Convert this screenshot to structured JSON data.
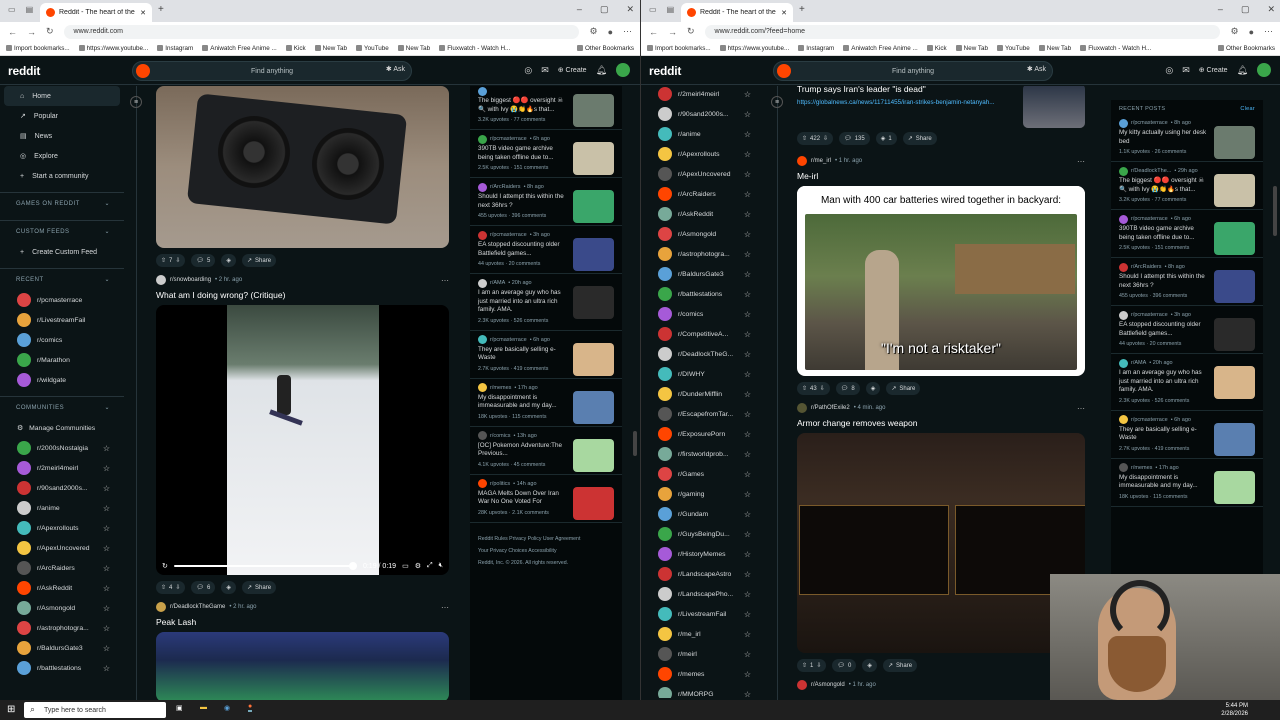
{
  "tab_title": "Reddit - The heart of the intern",
  "left_url": "www.reddit.com",
  "right_url": "www.reddit.com/?feed=home",
  "bookmarks": [
    "Import bookmarks...",
    "https://www.youtube...",
    "Instagram",
    "Aniwatch Free Anime ...",
    "Kick",
    "New Tab",
    "YouTube",
    "New Tab",
    "Fluxwatch - Watch H..."
  ],
  "other_bookmarks": "Other Bookmarks",
  "header": {
    "logo": "reddit",
    "search_placeholder": "Find anything",
    "ask": "Ask",
    "create": "Create"
  },
  "nav": [
    "Home",
    "Popular",
    "News",
    "Explore",
    "Start a community"
  ],
  "sections": {
    "games": "GAMES ON REDDIT",
    "custom": "CUSTOM FEEDS",
    "custom_item": "Create Custom Feed",
    "recent": "RECENT",
    "communities": "COMMUNITIES",
    "manage": "Manage Communities"
  },
  "recent": [
    "r/pcmasterrace",
    "r/LivestreamFail",
    "r/comics",
    "r/Marathon",
    "r/wildgate"
  ],
  "communities_left": [
    "r/2000sNostalgia",
    "r/2meirl4meirl",
    "r/90sand2000s...",
    "r/anime",
    "r/Apexrollouts",
    "r/ApexUncovered",
    "r/ArcRaiders",
    "r/AskReddit",
    "r/Asmongold",
    "r/astrophotogra...",
    "r/BaldursGate3",
    "r/battlestations"
  ],
  "communities_right": [
    "r/2meirl4meirl",
    "r/90sand2000s...",
    "r/anime",
    "r/Apexrollouts",
    "r/ApexUncovered",
    "r/ArcRaiders",
    "r/AskReddit",
    "r/Asmongold",
    "r/astrophotogra...",
    "r/BaldursGate3",
    "r/battlestations",
    "r/comics",
    "r/CompetitiveA...",
    "r/DeadlockTheG...",
    "r/DIWHY",
    "r/DunderMifflin",
    "r/EscapefromTar...",
    "r/ExposurePorn",
    "r/firstworldprob...",
    "r/Games",
    "r/gaming",
    "r/Gundam",
    "r/GuysBeingDu...",
    "r/HistoryMemes",
    "r/LandscapeAstro",
    "r/LandscapePho...",
    "r/LivestreamFail",
    "r/me_irl",
    "r/meirl",
    "r/memes",
    "r/MMORPG"
  ],
  "left_feed": [
    {
      "votes": "7",
      "comments": "5",
      "share": "Share"
    },
    {
      "sub": "r/snowboarding",
      "time": "• 2 hr. ago",
      "title": "What am I doing wrong? (Critique)",
      "video_time": "0:19 / 0:19",
      "votes": "4",
      "comments": "6",
      "share": "Share"
    },
    {
      "sub": "r/DeadlockTheGame",
      "time": "• 2 hr. ago",
      "title": "Peak Lash"
    }
  ],
  "rail_left": [
    {
      "sub": "",
      "time": "",
      "title": "The biggest 🔴🔴 oversight ☠🔍 with Ivy 😭👏🔥s that...",
      "stats": "3.2K upvotes · 77 comments"
    },
    {
      "sub": "r/pcmasterrace",
      "time": "• 6h ago",
      "title": "390TB video game archive being taken offline due to...",
      "stats": "2.5K upvotes · 151 comments"
    },
    {
      "sub": "r/ArcRaiders",
      "time": "• 8h ago",
      "title": "Should I attempt this within the next 36hrs ?",
      "stats": "455 upvotes · 396 comments"
    },
    {
      "sub": "r/pcmasterrace",
      "time": "• 3h ago",
      "title": "EA stopped discounting older Battlefield games...",
      "stats": "44 upvotes · 20 comments"
    },
    {
      "sub": "r/AMA",
      "time": "• 20h ago",
      "title": "I am an average guy who has just married into an ultra rich family. AMA.",
      "stats": "2.3K upvotes · 526 comments"
    },
    {
      "sub": "r/pcmasterrace",
      "time": "• 6h ago",
      "title": "They are basically selling e-Waste",
      "stats": "2.7K upvotes · 419 comments"
    },
    {
      "sub": "r/memes",
      "time": "• 17h ago",
      "title": "My disappointment is immeasurable and my day...",
      "stats": "18K upvotes · 115 comments"
    },
    {
      "sub": "r/comics",
      "time": "• 13h ago",
      "title": "[OC] Pokemon Adventure:The Previous...",
      "stats": "4.1K upvotes · 45 comments"
    },
    {
      "sub": "r/politics",
      "time": "• 14h ago",
      "title": "MAGA Melts Down Over Iran War No One Voted For",
      "stats": "28K upvotes · 2.1K comments"
    }
  ],
  "footer": [
    "Reddit Rules",
    "Privacy Policy",
    "User Agreement",
    "Your Privacy Choices",
    "Accessibility",
    "Reddit, Inc. © 2026. All rights reserved."
  ],
  "right_feed": [
    {
      "title": "Trump says Iran's leader \"is dead\"",
      "link": "https://globalnews.ca/news/11711455/iran-strikes-benjamin-netanyah...",
      "votes": "422",
      "comments": "135",
      "award": "1",
      "share": "Share"
    },
    {
      "sub": "r/me_irl",
      "time": "• 1 hr. ago",
      "title": "Me-irl",
      "caption": "Man with 400 car batteries wired together in backyard:",
      "subtitle": "\"I'm not a risktaker\"",
      "votes": "43",
      "comments": "8",
      "share": "Share"
    },
    {
      "sub": "r/PathOfExile2",
      "time": "• 4 min. ago",
      "title": "Armor change removes weapon",
      "votes": "1",
      "comments": "0",
      "share": "Share"
    },
    {
      "sub": "r/Asmongold",
      "time": "• 1 hr. ago"
    }
  ],
  "rail_right_header": {
    "title": "RECENT POSTS",
    "clear": "Clear"
  },
  "rail_right": [
    {
      "sub": "r/pcmasterrace",
      "time": "• 8h ago",
      "title": "My kitty actually using her desk bed",
      "stats": "1.1K upvotes · 26 comments"
    },
    {
      "sub": "r/DeadlockThe...",
      "time": "• 29h ago",
      "title": "The biggest 🔴🔴 oversight ☠🔍 with Ivy 😭👏🔥s that...",
      "stats": "3.2K upvotes · 77 comments"
    },
    {
      "sub": "r/pcmasterrace",
      "time": "• 6h ago",
      "title": "390TB video game archive being taken offline due to...",
      "stats": "2.5K upvotes · 151 comments"
    },
    {
      "sub": "r/ArcRaiders",
      "time": "• 8h ago",
      "title": "Should I attempt this within the next 36hrs ?",
      "stats": "455 upvotes · 396 comments"
    },
    {
      "sub": "r/pcmasterrace",
      "time": "• 3h ago",
      "title": "EA stopped discounting older Battlefield games...",
      "stats": "44 upvotes · 20 comments"
    },
    {
      "sub": "r/AMA",
      "time": "• 20h ago",
      "title": "I am an average guy who has just married into an ultra rich family. AMA.",
      "stats": "2.3K upvotes · 526 comments"
    },
    {
      "sub": "r/pcmasterrace",
      "time": "• 6h ago",
      "title": "They are basically selling e-Waste",
      "stats": "2.7K upvotes · 419 comments"
    },
    {
      "sub": "r/memes",
      "time": "• 17h ago",
      "title": "My disappointment is immeasurable and my day...",
      "stats": "18K upvotes · 115 comments"
    }
  ],
  "taskbar": {
    "search": "Type here to search",
    "time": "5:44 PM",
    "date": "2/28/2026"
  }
}
